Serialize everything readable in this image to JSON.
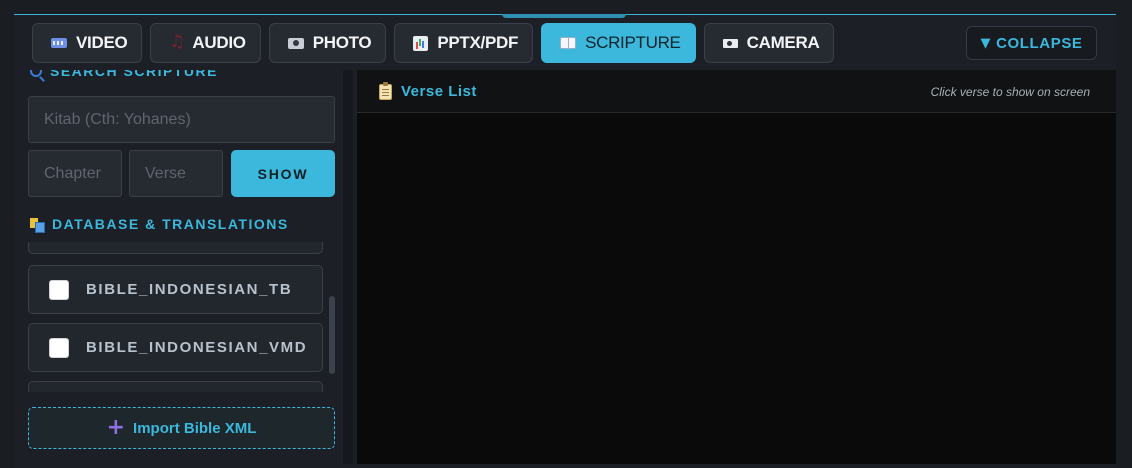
{
  "tabs": [
    {
      "label": "VIDEO",
      "icon": "video-icon",
      "active": false
    },
    {
      "label": "AUDIO",
      "icon": "music-note-icon",
      "active": false
    },
    {
      "label": "PHOTO",
      "icon": "camera-photo-icon",
      "active": false
    },
    {
      "label": "PPTX/PDF",
      "icon": "chart-icon",
      "active": false
    },
    {
      "label": "SCRIPTURE",
      "icon": "book-icon",
      "active": true
    },
    {
      "label": "CAMERA",
      "icon": "video-camera-icon",
      "active": false
    }
  ],
  "collapse": {
    "arrow": "▼",
    "label": "COLLAPSE"
  },
  "search": {
    "title": "SEARCH SCRIPTURE",
    "book_placeholder": "Kitab (Cth: Yohanes)",
    "chapter_placeholder": "Chapter",
    "verse_placeholder": "Verse",
    "show_label": "SHOW"
  },
  "database": {
    "title": "DATABASE & TRANSLATIONS",
    "translations": [
      {
        "name": "BIBLE_INDONESIAN_TB",
        "checked": false
      },
      {
        "name": "BIBLE_INDONESIAN_VMD",
        "checked": false
      }
    ],
    "import_label": "Import Bible XML"
  },
  "verse_list": {
    "title": "Verse List",
    "hint": "Click verse to show on screen"
  },
  "colors": {
    "accent": "#3cb8dc",
    "background": "#1c2026",
    "panel_dark": "#0a0a0a"
  }
}
